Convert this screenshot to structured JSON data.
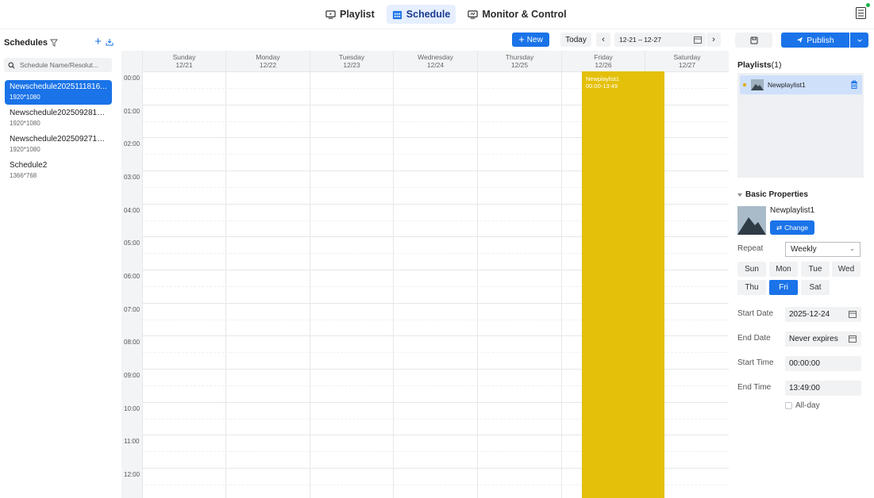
{
  "topnav": {
    "tabs": [
      {
        "label": "Playlist",
        "icon": "playlist-icon"
      },
      {
        "label": "Schedule",
        "icon": "calendar-grid-icon",
        "active": true
      },
      {
        "label": "Monitor & Control",
        "icon": "monitor-icon"
      }
    ]
  },
  "sidebar": {
    "title": "Schedules",
    "search_placeholder": "Schedule Name/Resolut...",
    "items": [
      {
        "name": "Newschedule2025111816...",
        "resolution": "1920*1080",
        "active": true
      },
      {
        "name": "Newschedule2025092814...",
        "resolution": "1920*1080"
      },
      {
        "name": "Newschedule2025092712...",
        "resolution": "1920*1080"
      },
      {
        "name": "Schedule2",
        "resolution": "1366*768"
      }
    ]
  },
  "toolbar": {
    "new_label": "New",
    "today_label": "Today",
    "date_range": "12-21 – 12-27"
  },
  "calendar": {
    "days": [
      {
        "name": "Sunday",
        "date": "12/21"
      },
      {
        "name": "Monday",
        "date": "12/22"
      },
      {
        "name": "Tuesday",
        "date": "12/23"
      },
      {
        "name": "Wednesday",
        "date": "12/24"
      },
      {
        "name": "Thursday",
        "date": "12/25"
      },
      {
        "name": "Friday",
        "date": "12/26"
      },
      {
        "name": "Saturday",
        "date": "12/27"
      }
    ],
    "hours": [
      "00:00",
      "01:00",
      "02:00",
      "03:00",
      "04:00",
      "05:00",
      "06:00",
      "07:00",
      "08:00",
      "09:00",
      "10:00",
      "11:00",
      "12:00"
    ],
    "event": {
      "title": "Newplaylist1",
      "time": "00:00-13:49",
      "day": "Friday",
      "color": "#e4c00a"
    }
  },
  "right_panel": {
    "publish_label": "Publish",
    "playlists_title": "Playlists",
    "playlists_count": "(1)",
    "playlist_item": "Newplaylist1",
    "basic_properties_title": "Basic Properties",
    "selected_playlist": "Newplaylist1",
    "change_label": "Change",
    "repeat_label": "Repeat",
    "repeat_value": "Weekly",
    "weekdays": [
      {
        "label": "Sun"
      },
      {
        "label": "Mon"
      },
      {
        "label": "Tue"
      },
      {
        "label": "Wed"
      },
      {
        "label": "Thu"
      },
      {
        "label": "Fri",
        "active": true
      },
      {
        "label": "Sat"
      }
    ],
    "start_date_label": "Start Date",
    "start_date_value": "2025-12-24",
    "end_date_label": "End Date",
    "end_date_value": "Never expires",
    "start_time_label": "Start Time",
    "start_time_value": "00:00:00",
    "end_time_label": "End Time",
    "end_time_value": "13:49:00",
    "allday_label": "All-day"
  },
  "colors": {
    "accent": "#1a73e8",
    "event": "#e4c00a",
    "status_online": "#19b34a"
  }
}
